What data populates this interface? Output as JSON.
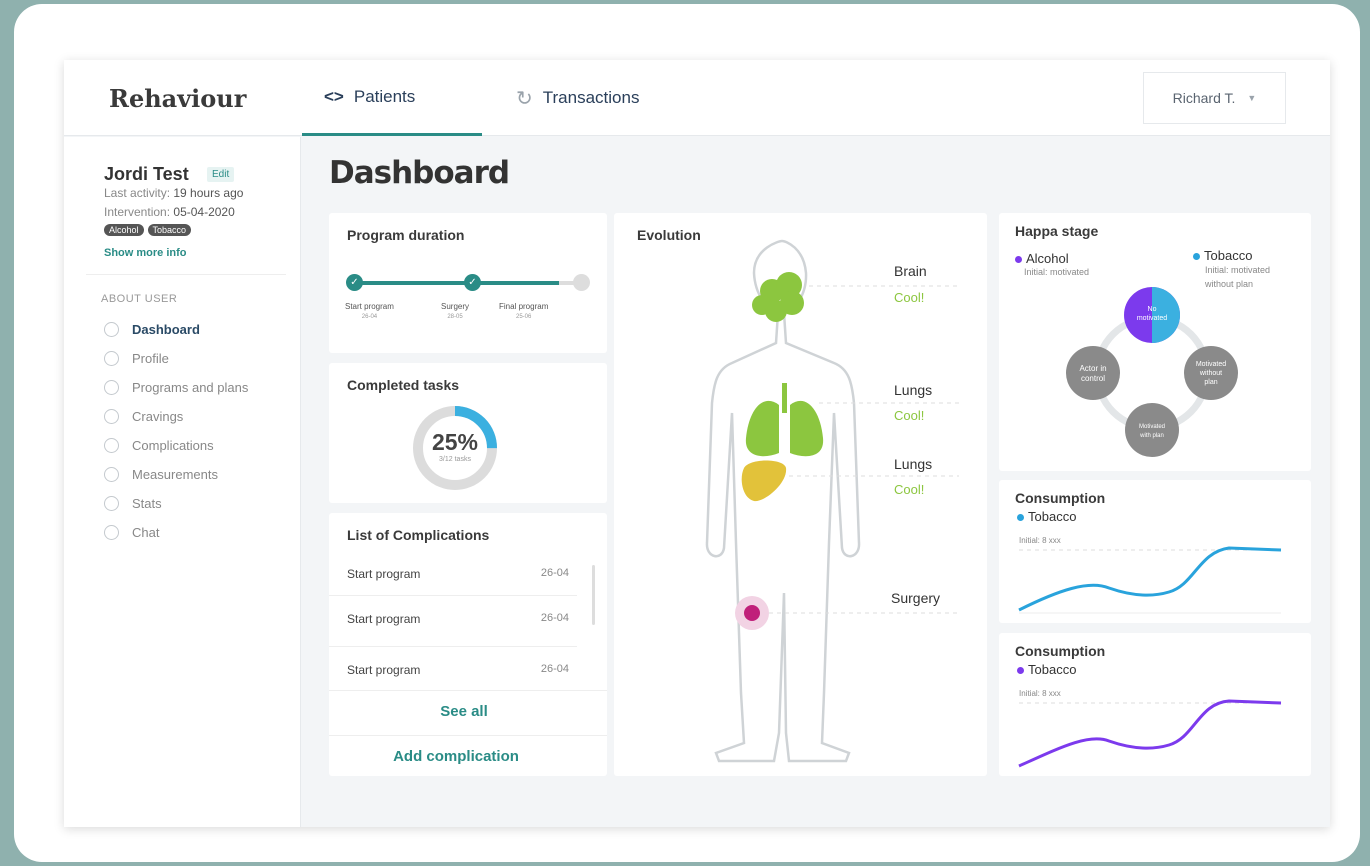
{
  "app": {
    "brand": "Rehaviour"
  },
  "nav": {
    "tabs": [
      {
        "label": "Patients",
        "icon": "code-icon",
        "active": true
      },
      {
        "label": "Transactions",
        "icon": "sync-icon",
        "active": false
      }
    ],
    "user": "Richard T."
  },
  "sidebar": {
    "patient_name": "Jordi Test",
    "edit_label": "Edit",
    "last_activity_label": "Last activity:",
    "last_activity_value": "19 hours ago",
    "intervention_label": "Intervention:",
    "intervention_value": "05-04-2020",
    "tags": [
      "Alcohol",
      "Tobacco"
    ],
    "more_info": "Show more info",
    "section_label": "ABOUT USER",
    "menu": [
      {
        "label": "Dashboard",
        "active": true
      },
      {
        "label": "Profile"
      },
      {
        "label": "Programs and plans"
      },
      {
        "label": "Cravings"
      },
      {
        "label": "Complications"
      },
      {
        "label": "Measurements"
      },
      {
        "label": "Stats"
      },
      {
        "label": "Chat"
      }
    ]
  },
  "dashboard": {
    "title": "Dashboard",
    "program_duration": {
      "title": "Program duration",
      "progress": 0.85,
      "steps": [
        {
          "label": "Start program",
          "date": "26-04"
        },
        {
          "label": "Surgery",
          "date": "28-05"
        },
        {
          "label": "Final program",
          "date": "25-06"
        }
      ]
    },
    "completed_tasks": {
      "title": "Completed tasks",
      "percent": "25%",
      "fraction": 0.25,
      "sub": "3/12 tasks"
    },
    "complications": {
      "title": "List of Complications",
      "rows": [
        {
          "name": "Start program",
          "date": "26-04"
        },
        {
          "name": "Start program",
          "date": "26-04"
        },
        {
          "name": "Start program",
          "date": "26-04"
        }
      ],
      "see_all": "See all",
      "add": "Add complication"
    },
    "evolution": {
      "title": "Evolution",
      "organs": [
        {
          "label": "Brain",
          "status": "Cool!"
        },
        {
          "label": "Lungs",
          "status": "Cool!"
        },
        {
          "label": "Lungs",
          "status": "Cool!"
        },
        {
          "label": "Surgery",
          "status": ""
        }
      ]
    },
    "happa": {
      "title": "Happa stage",
      "alcohol": {
        "label": "Alcohol",
        "sub": "Initial: motivated",
        "color": "#7c3aed"
      },
      "tobacco": {
        "label": "Tobacco",
        "sub1": "Initial: motivated",
        "sub2": "without plan",
        "color": "#29a3dc"
      },
      "stages": [
        {
          "line1": "No",
          "line2": "motivated",
          "line3": ""
        },
        {
          "line1": "Motivated",
          "line2": "without",
          "line3": "plan"
        },
        {
          "line1": "Motivated",
          "line2": "with plan",
          "line3": ""
        },
        {
          "line1": "Actor in",
          "line2": "control",
          "line3": ""
        }
      ]
    },
    "consumption": [
      {
        "title": "Consumption",
        "legend": "Tobacco",
        "initial": "Initial: 8 xxx",
        "color": "#29a3dc"
      },
      {
        "title": "Consumption",
        "legend": "Tobacco",
        "initial": "Initial: 8 xxx",
        "color": "#7c3aed"
      }
    ]
  }
}
